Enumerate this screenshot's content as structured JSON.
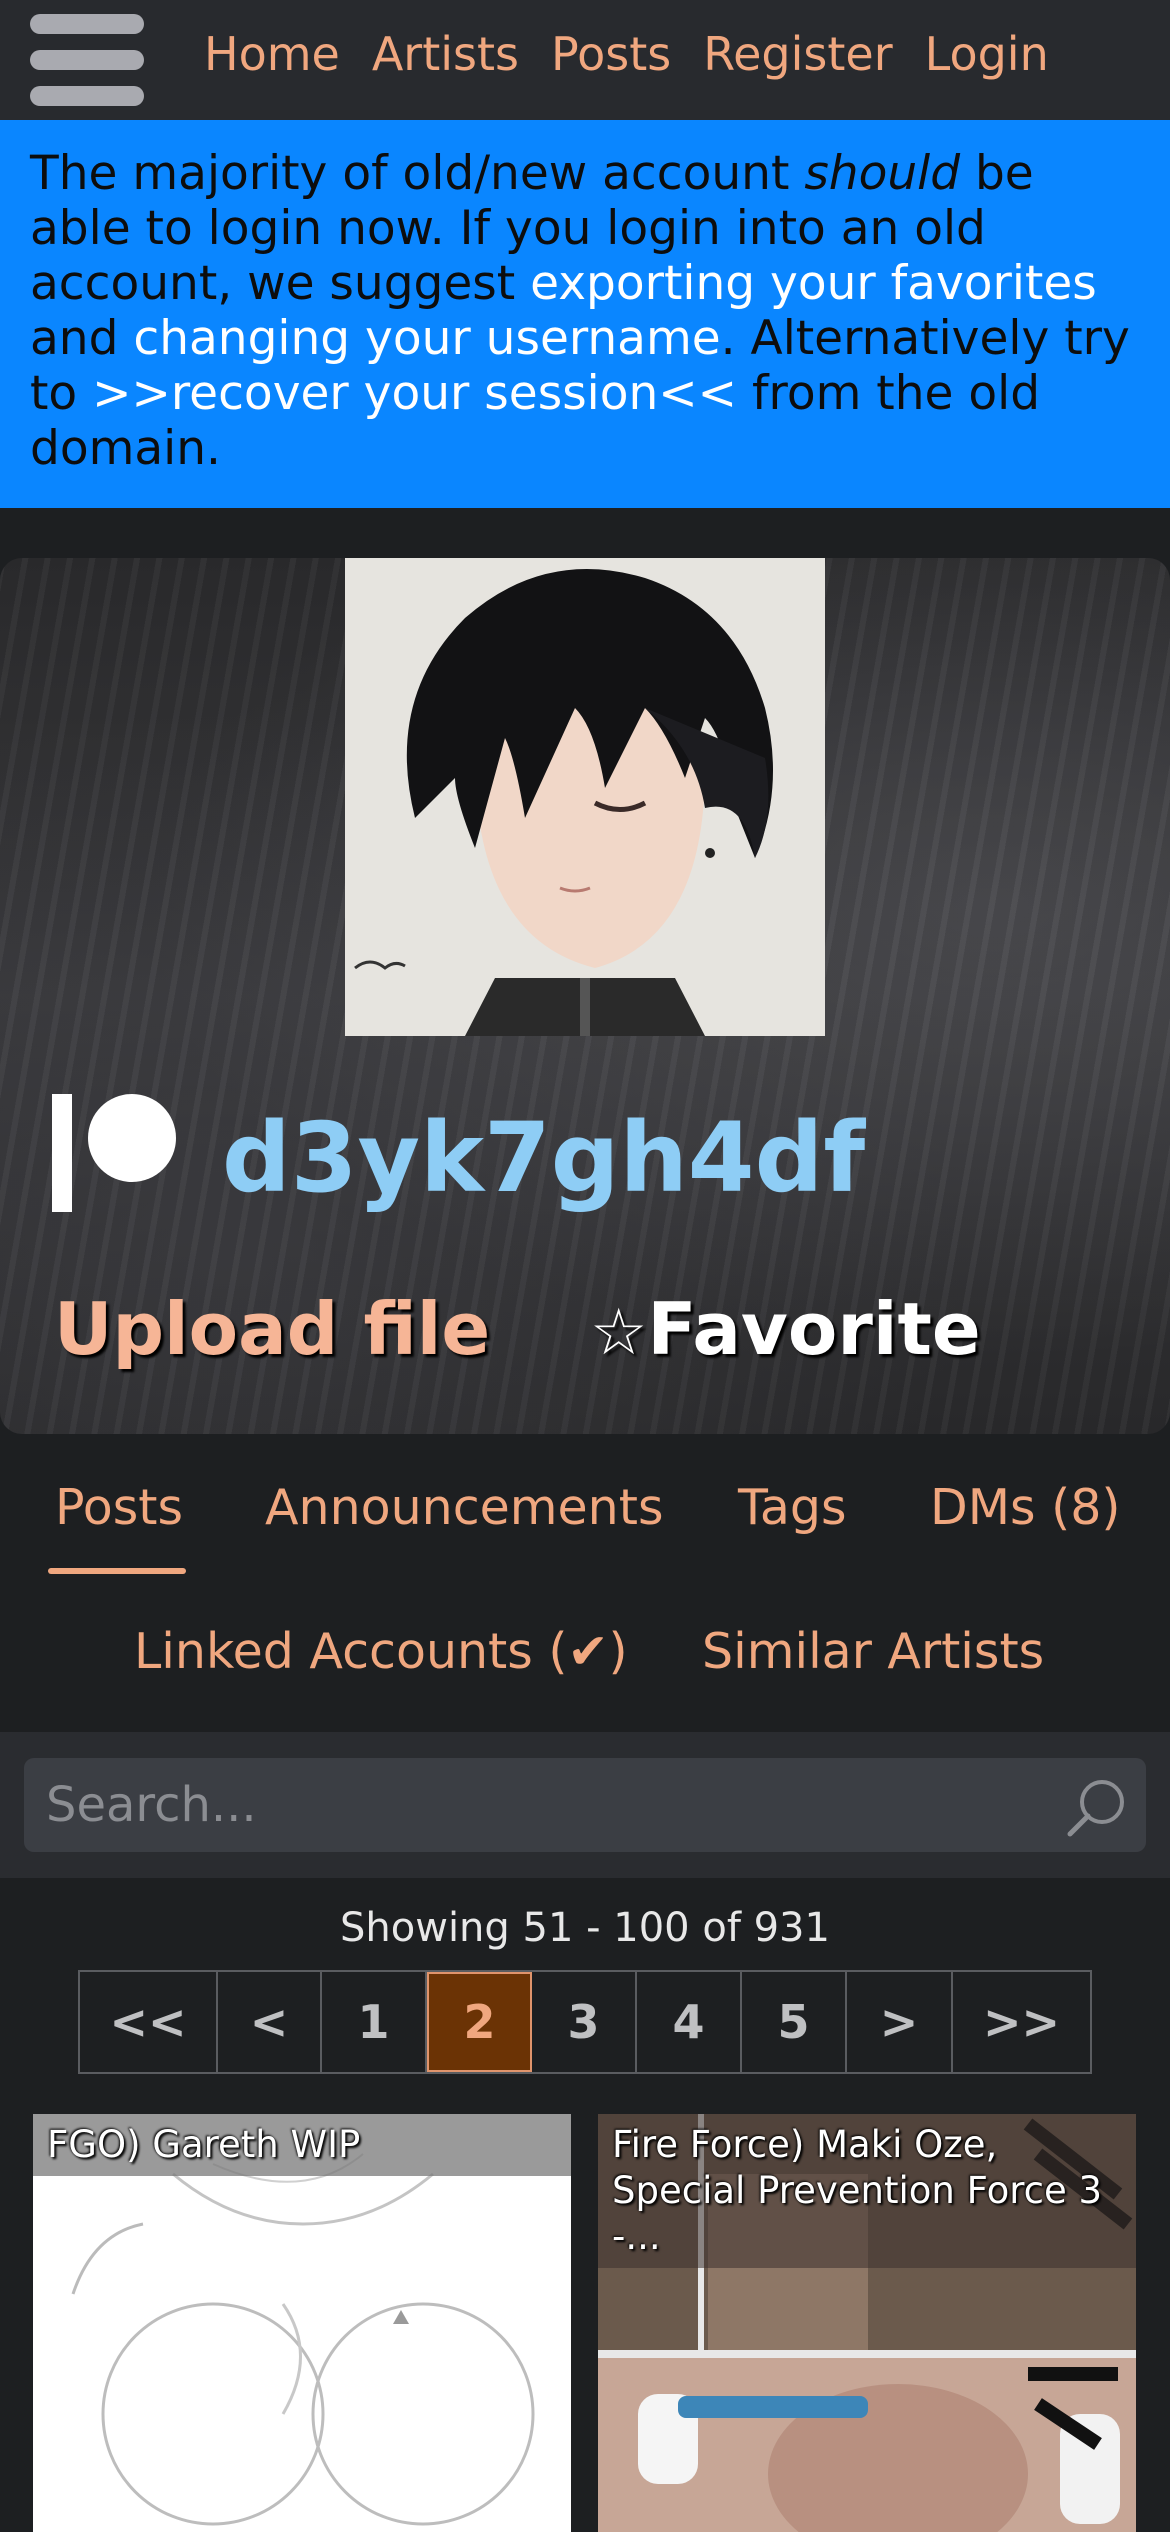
{
  "nav": {
    "links": [
      "Home",
      "Artists",
      "Posts",
      "Register",
      "Login"
    ]
  },
  "banner": {
    "text_1": "The majority of old/new account ",
    "emphasis": "should",
    "text_2": " be able to login now. If you login into an old account, we suggest ",
    "link_export": "exporting your favorites",
    "text_3": " and ",
    "link_username": "changing your username",
    "text_4": ". Alternatively try to ",
    "link_recover": ">>recover your session<<",
    "text_5": " from the old domain."
  },
  "profile": {
    "artist_name": "d3yk7gh4df",
    "platform_icon": "patreon-icon",
    "upload_label": "Upload file",
    "favorite_star": "☆",
    "favorite_label": "Favorite"
  },
  "tabs": {
    "items": [
      "Posts",
      "Announcements",
      "Tags",
      "DMs (8)",
      "Linked Accounts (✔)",
      "Similar Artists"
    ],
    "active": "Posts"
  },
  "search": {
    "placeholder": "Search..."
  },
  "pagination": {
    "showing": "Showing 51 - 100 of 931",
    "pages": [
      "<<",
      "<",
      "1",
      "2",
      "3",
      "4",
      "5",
      ">",
      ">>"
    ],
    "current": "2"
  },
  "posts": [
    {
      "title": "FGO) Gareth WIP"
    },
    {
      "title": "Fire Force) Maki Oze, Special Prevention Force 3 -..."
    }
  ],
  "colors": {
    "accent": "#f0a77f",
    "banner": "#0a86ff",
    "artist_name": "#8ecdf5",
    "page_active": "#6b3305"
  }
}
